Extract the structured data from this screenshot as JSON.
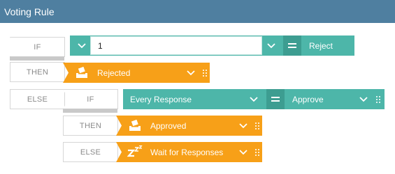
{
  "window": {
    "title": "Voting Rule"
  },
  "rule": {
    "if_label": "IF",
    "then_label": "THEN",
    "else_label": "ELSE",
    "condition": {
      "value": "1",
      "operator_icon": "equals-icon",
      "result": "Reject"
    },
    "then_action": {
      "label": "Rejected",
      "icon": "ballot-box-icon"
    },
    "else_block": {
      "if_label": "IF",
      "then_label": "THEN",
      "else_label": "ELSE",
      "condition": {
        "field": "Every Response",
        "operator_icon": "equals-icon",
        "result": "Approve"
      },
      "then_action": {
        "label": "Approved",
        "icon": "ballot-box-icon"
      },
      "else_action": {
        "label": "Wait for Responses",
        "icon": "sleep-zzz-icon"
      }
    }
  },
  "colors": {
    "header": "#4f7fa0",
    "teal": "#4db6a9",
    "teal_dark": "#3d9d91",
    "orange": "#f7a018"
  }
}
